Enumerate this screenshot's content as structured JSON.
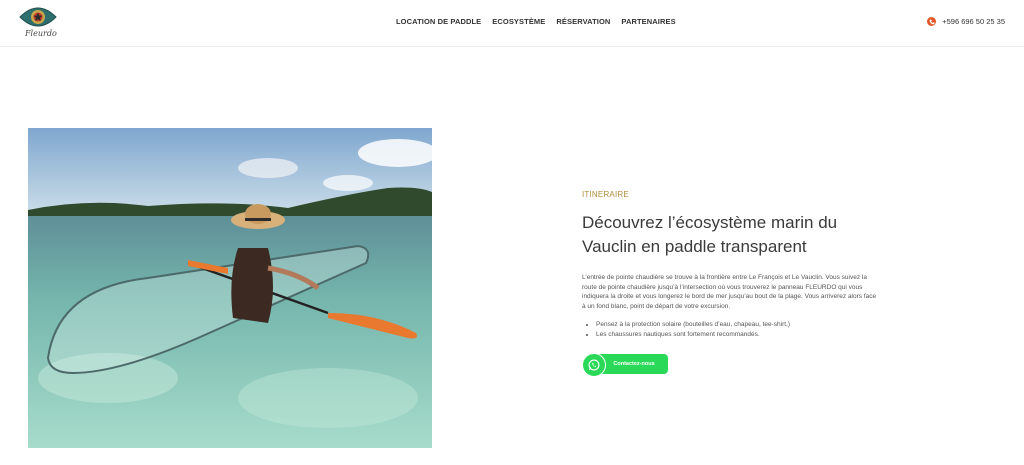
{
  "header": {
    "logo_text": "Fleurdo",
    "nav": [
      "LOCATION DE PADDLE",
      "ECOSYSTÈME",
      "RÉSERVATION",
      "PARTENAIRES"
    ],
    "phone": "+596 696 50 25 35"
  },
  "section": {
    "eyebrow": "ITINERAIRE",
    "title": "Découvrez l’écosystème marin du Vauclin en paddle transparent",
    "paragraph": "L’entrée de pointe chaudière se trouve à la frontière entre Le François et Le Vauclin. Vous suivez la route de pointe chaudière jusqu’à l’intersection où vous trouverez le panneau FLEURDO qui vous indiquera la droite et vous longerez le bord de mer jusqu’au bout de la plage. Vous arriverez alors face à un fond blanc, point de départ de votre excursion.",
    "bullets": [
      "Pensez à la protection solaire (bouteilles d’eau, chapeau, tee-shirt,)",
      "Les chaussures nautiques sont fortement recommandés."
    ],
    "cta_label": "Contactez-nous"
  },
  "icons": {
    "logo": "eye-logo-icon",
    "phone": "phone-icon",
    "whatsapp": "whatsapp-icon"
  },
  "colors": {
    "accent": "#b08d3c",
    "phone_icon": "#e2582b",
    "cta": "#2bd959"
  }
}
